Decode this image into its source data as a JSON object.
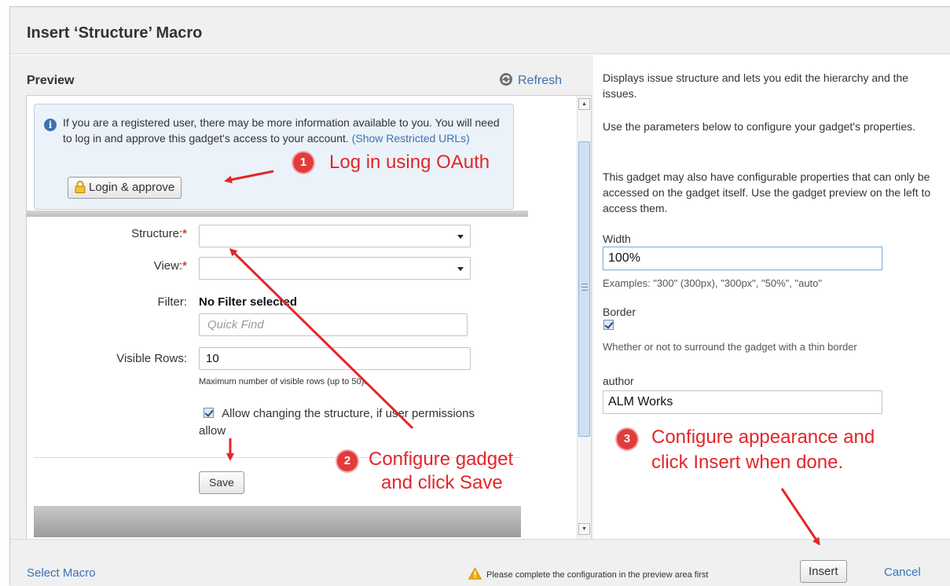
{
  "dialog": {
    "title": "Insert ‘Structure’ Macro"
  },
  "preview": {
    "title": "Preview",
    "refresh_label": "Refresh",
    "oauth": {
      "message": "If you are a registered user, there may be more information available to you. You will need to log in and approve this gadget's access to your account.",
      "restricted_link": "(Show Restricted URLs)",
      "login_button": "Login & approve"
    },
    "form": {
      "structure_label": "Structure:",
      "structure_value": "",
      "view_label": "View:",
      "view_value": "",
      "required_marker": "*",
      "filter_label": "Filter:",
      "filter_value": "No Filter selected",
      "quick_find_placeholder": "Quick Find",
      "visible_rows_label": "Visible Rows:",
      "visible_rows_value": "10",
      "visible_rows_hint": "Maximum number of visible rows (up to 50).",
      "allow_change_label": "Allow changing the structure, if user permissions allow",
      "allow_change_checked": true,
      "save_button": "Save"
    }
  },
  "config": {
    "description": "Displays issue structure and lets you edit the hierarchy and the issues.",
    "params_note": "Use the parameters below to configure your gadget's properties.",
    "gadget_note": "This gadget may also have configurable properties that can only be accessed on the gadget itself. Use the gadget preview on the left to access them.",
    "width_label": "Width",
    "width_value": "100%",
    "width_examples": "Examples: \"300\" (300px), \"300px\", \"50%\", \"auto\"",
    "border_label": "Border",
    "border_checked": true,
    "border_hint": "Whether or not to surround the gadget with a thin border",
    "author_label": "author",
    "author_value": "ALM Works"
  },
  "footer": {
    "select_macro": "Select Macro",
    "warning": "Please complete the configuration in the preview area first",
    "insert_button": "Insert",
    "cancel": "Cancel"
  },
  "annotations": [
    {
      "number": "1",
      "text": "Log in using OAuth"
    },
    {
      "number": "2",
      "line1": "Configure gadget",
      "line2": "and click Save"
    },
    {
      "number": "3",
      "line1": "Configure appearance and",
      "line2": "click Insert when done."
    }
  ],
  "colors": {
    "accent_link": "#3b73af",
    "required": "#d04437",
    "annotation_red": "#e3262a",
    "header_bg": "#f0f0f0",
    "info_box_bg": "#ebf2f9"
  },
  "icons": [
    "refresh-icon",
    "info-icon",
    "lock-icon",
    "warning-icon",
    "chevron-down-icon",
    "scroll-up-icon",
    "scroll-down-icon"
  ]
}
